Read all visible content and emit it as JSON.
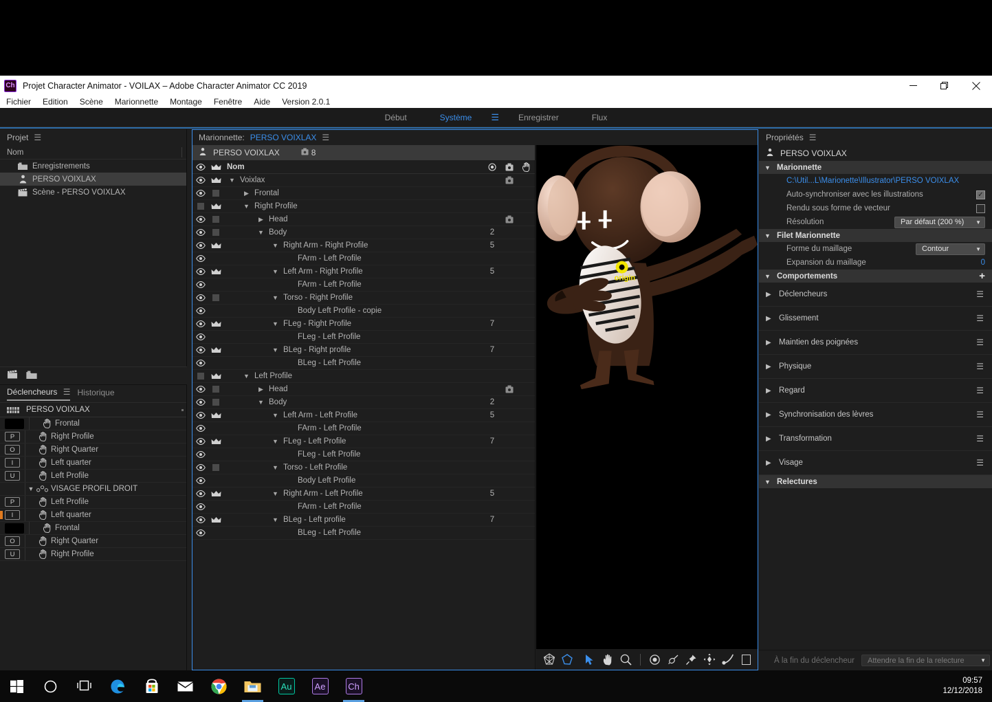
{
  "window": {
    "app_badge": "Ch",
    "title": "Projet Character Animator - VOILAX – Adobe Character Animator CC 2019",
    "minimize": "minimize-icon",
    "maximize": "maximize-icon",
    "close": "close-icon"
  },
  "menubar": {
    "items": [
      "Fichier",
      "Edition",
      "Scène",
      "Marionnette",
      "Montage",
      "Fenêtre",
      "Aide",
      "Version 2.0.1"
    ]
  },
  "workspace_bar": {
    "items": [
      {
        "label": "Début",
        "active": false
      },
      {
        "label": "Système",
        "active": true
      },
      {
        "label": "Enregistrer",
        "active": false
      },
      {
        "label": "Flux",
        "active": false
      }
    ]
  },
  "project_panel": {
    "title": "Projet",
    "column_header": "Nom",
    "rows": [
      {
        "label": "Enregistrements",
        "icon": "folder-icon",
        "selected": false
      },
      {
        "label": "PERSO VOIXLAX",
        "icon": "puppet-icon",
        "selected": true
      },
      {
        "label": "Scène - PERSO VOIXLAX",
        "icon": "clapperboard-icon",
        "selected": false
      }
    ],
    "footer_icons": [
      "clapperboard-icon",
      "folder-icon"
    ]
  },
  "triggers_panel": {
    "tabs": [
      {
        "label": "Déclencheurs",
        "active": true
      },
      {
        "label": "Historique",
        "active": false
      }
    ],
    "subject": "PERSO VOIXLAX",
    "rows": [
      {
        "key": "",
        "blank": true,
        "label": "Frontal",
        "icon": "hand-icon",
        "marker": false,
        "group": false
      },
      {
        "key": "P",
        "blank": false,
        "label": "Right Profile",
        "icon": "hand-icon",
        "marker": false,
        "group": false
      },
      {
        "key": "O",
        "blank": false,
        "label": "Right Quarter",
        "icon": "hand-icon",
        "marker": false,
        "group": false
      },
      {
        "key": "I",
        "blank": false,
        "label": "Left quarter",
        "icon": "hand-icon",
        "marker": false,
        "group": false
      },
      {
        "key": "U",
        "blank": false,
        "label": "Left Profile",
        "icon": "hand-icon",
        "marker": false,
        "group": false
      },
      {
        "key": "",
        "blank": false,
        "label": "VISAGE PROFIL DROIT",
        "icon": "swap-set-icon",
        "marker": false,
        "group": true
      },
      {
        "key": "P",
        "blank": false,
        "label": "Left Profile",
        "icon": "hand-icon",
        "marker": false,
        "group": false
      },
      {
        "key": "I",
        "blank": false,
        "label": "Left quarter",
        "icon": "hand-icon",
        "marker": true,
        "group": false
      },
      {
        "key": "",
        "blank": true,
        "label": "Frontal",
        "icon": "hand-icon",
        "marker": false,
        "group": false
      },
      {
        "key": "O",
        "blank": false,
        "label": "Right Quarter",
        "icon": "hand-icon",
        "marker": false,
        "group": false
      },
      {
        "key": "U",
        "blank": false,
        "label": "Right Profile",
        "icon": "hand-icon",
        "marker": false,
        "group": false
      }
    ]
  },
  "puppet_panel": {
    "header_label": "Marionnette:",
    "header_value": "PERSO VOIXLAX",
    "subject": "PERSO VOIXLAX",
    "subject_badge_count": "8",
    "column_headers": {
      "name": "Nom",
      "eye": "eye-icon",
      "crown": "crown-icon",
      "record": "record-icon",
      "tag": "tag-icon",
      "hand": "hand-icon"
    },
    "layers": [
      {
        "indent": 0,
        "tri": "v",
        "name": "Voixlax",
        "eye": true,
        "crown": true,
        "num": "",
        "tag": true
      },
      {
        "indent": 1,
        "tri": ">",
        "name": "Frontal",
        "eye": true,
        "crown": "sq",
        "num": "",
        "tag": false
      },
      {
        "indent": 1,
        "tri": "v",
        "name": "Right Profile",
        "eye": "sq",
        "crown": true,
        "num": "",
        "tag": false
      },
      {
        "indent": 2,
        "tri": ">",
        "name": "Head",
        "eye": true,
        "crown": "sq",
        "num": "",
        "tag": true
      },
      {
        "indent": 2,
        "tri": "v",
        "name": "Body",
        "eye": true,
        "crown": "sq",
        "num": "2",
        "tag": false
      },
      {
        "indent": 3,
        "tri": "v",
        "name": "Right Arm - Right Profile",
        "eye": true,
        "crown": true,
        "num": "5",
        "tag": false
      },
      {
        "indent": 4,
        "tri": "",
        "name": "FArm - Left Profile",
        "eye": true,
        "crown": false,
        "num": "",
        "tag": false
      },
      {
        "indent": 3,
        "tri": "v",
        "name": "Left Arm - Right Profile",
        "eye": true,
        "crown": true,
        "num": "5",
        "tag": false
      },
      {
        "indent": 4,
        "tri": "",
        "name": "FArm - Left Profile",
        "eye": true,
        "crown": false,
        "num": "",
        "tag": false
      },
      {
        "indent": 3,
        "tri": "v",
        "name": "Torso - Right Profile",
        "eye": true,
        "crown": "sq",
        "num": "",
        "tag": false
      },
      {
        "indent": 4,
        "tri": "",
        "name": "Body Left Profile - copie",
        "eye": true,
        "crown": false,
        "num": "",
        "tag": false
      },
      {
        "indent": 3,
        "tri": "v",
        "name": "FLeg - Right Profile",
        "eye": true,
        "crown": true,
        "num": "7",
        "tag": false
      },
      {
        "indent": 4,
        "tri": "",
        "name": "FLeg - Left Profile",
        "eye": true,
        "crown": false,
        "num": "",
        "tag": false
      },
      {
        "indent": 3,
        "tri": "v",
        "name": "BLeg - Right profile",
        "eye": true,
        "crown": true,
        "num": "7",
        "tag": false
      },
      {
        "indent": 4,
        "tri": "",
        "name": "BLeg - Left Profile",
        "eye": true,
        "crown": false,
        "num": "",
        "tag": false
      },
      {
        "indent": 1,
        "tri": "v",
        "name": "Left Profile",
        "eye": "sq",
        "crown": true,
        "num": "",
        "tag": false
      },
      {
        "indent": 2,
        "tri": ">",
        "name": "Head",
        "eye": true,
        "crown": "sq",
        "num": "",
        "tag": true
      },
      {
        "indent": 2,
        "tri": "v",
        "name": "Body",
        "eye": true,
        "crown": "sq",
        "num": "2",
        "tag": false
      },
      {
        "indent": 3,
        "tri": "v",
        "name": "Left Arm - Left Profile",
        "eye": true,
        "crown": true,
        "num": "5",
        "tag": false
      },
      {
        "indent": 4,
        "tri": "",
        "name": "FArm - Left Profile",
        "eye": true,
        "crown": false,
        "num": "",
        "tag": false
      },
      {
        "indent": 3,
        "tri": "v",
        "name": "FLeg - Left Profile",
        "eye": true,
        "crown": true,
        "num": "7",
        "tag": false
      },
      {
        "indent": 4,
        "tri": "",
        "name": "FLeg - Left Profile",
        "eye": true,
        "crown": false,
        "num": "",
        "tag": false
      },
      {
        "indent": 3,
        "tri": "v",
        "name": "Torso - Left Profile",
        "eye": true,
        "crown": "sq",
        "num": "",
        "tag": false
      },
      {
        "indent": 4,
        "tri": "",
        "name": "Body Left Profile",
        "eye": true,
        "crown": false,
        "num": "",
        "tag": false
      },
      {
        "indent": 3,
        "tri": "v",
        "name": "Right Arm - Left Profile",
        "eye": true,
        "crown": true,
        "num": "5",
        "tag": false
      },
      {
        "indent": 4,
        "tri": "",
        "name": "FArm - Left Profile",
        "eye": true,
        "crown": false,
        "num": "",
        "tag": false
      },
      {
        "indent": 3,
        "tri": "v",
        "name": "BLeg - Left profile",
        "eye": true,
        "crown": true,
        "num": "7",
        "tag": false
      },
      {
        "indent": 4,
        "tri": "",
        "name": "BLeg - Left Profile",
        "eye": true,
        "crown": false,
        "num": "",
        "tag": false
      }
    ],
    "canvas_tools": [
      "mesh-icon",
      "polygon-icon",
      "selection-arrow-icon",
      "hand-tool-icon",
      "zoom-tool-icon",
      "origin-handle-icon",
      "dangle-handle-icon",
      "pin-handle-icon",
      "draggable-handle-icon",
      "stick-handle-icon"
    ],
    "canvas_artwork": {
      "character_name": "Voixlax",
      "origin_label": "origin",
      "skin_color": "#3b2318",
      "headphone_color": "#e8c4b0",
      "mic_color": "#efe6de",
      "background": "#000000"
    }
  },
  "properties_panel": {
    "title": "Propriétés",
    "object_name": "PERSO VOIXLAX",
    "sections": {
      "puppet": {
        "title": "Marionnette",
        "path": "C:\\Util...L\\Marionette\\Illustrator\\PERSO VOIXLAX",
        "rows": [
          {
            "label": "Auto-synchroniser avec les illustrations",
            "type": "checkbox",
            "checked": true
          },
          {
            "label": "Rendu sous forme de vecteur",
            "type": "checkbox",
            "checked": false
          },
          {
            "label": "Résolution",
            "type": "select",
            "value": "Par défaut (200 %)"
          }
        ]
      },
      "mesh": {
        "title": "Filet Marionnette",
        "rows": [
          {
            "label": "Forme du maillage",
            "type": "select",
            "value": "Contour"
          },
          {
            "label": "Expansion du maillage",
            "type": "number",
            "value": "0"
          }
        ]
      },
      "behaviors": {
        "title": "Comportements",
        "add": "+",
        "items": [
          "Déclencheurs",
          "Glissement",
          "Maintien des poignées",
          "Physique",
          "Regard",
          "Synchronisation des lèvres",
          "Transformation",
          "Visage"
        ]
      },
      "replays": {
        "title": "Relectures",
        "footer_label": "À la fin du déclencheur",
        "footer_value": "Attendre la fin de la relecture"
      }
    }
  },
  "taskbar": {
    "items": [
      {
        "name": "start-button",
        "icon": "windows-logo-icon"
      },
      {
        "name": "cortana-search",
        "icon": "circle-icon"
      },
      {
        "name": "task-view",
        "icon": "task-view-icon"
      },
      {
        "name": "edge",
        "icon": "edge-icon"
      },
      {
        "name": "microsoft-store",
        "icon": "store-icon"
      },
      {
        "name": "mail",
        "icon": "mail-icon"
      },
      {
        "name": "chrome",
        "icon": "chrome-icon"
      },
      {
        "name": "file-explorer",
        "icon": "folder-icon",
        "open": true
      },
      {
        "name": "adobe-audition",
        "icon": "au-icon",
        "label": "Au"
      },
      {
        "name": "adobe-after-effects",
        "icon": "ae-icon",
        "label": "Ae"
      },
      {
        "name": "adobe-character-animator",
        "icon": "ch-icon",
        "label": "Ch",
        "open": true
      }
    ],
    "clock_time": "09:57",
    "clock_date": "12/12/2018"
  },
  "colors": {
    "accent_blue": "#3b8eea",
    "panel_bg": "#1e1e1e",
    "section_bg": "#333333",
    "selected_row": "#3d3d3d"
  }
}
